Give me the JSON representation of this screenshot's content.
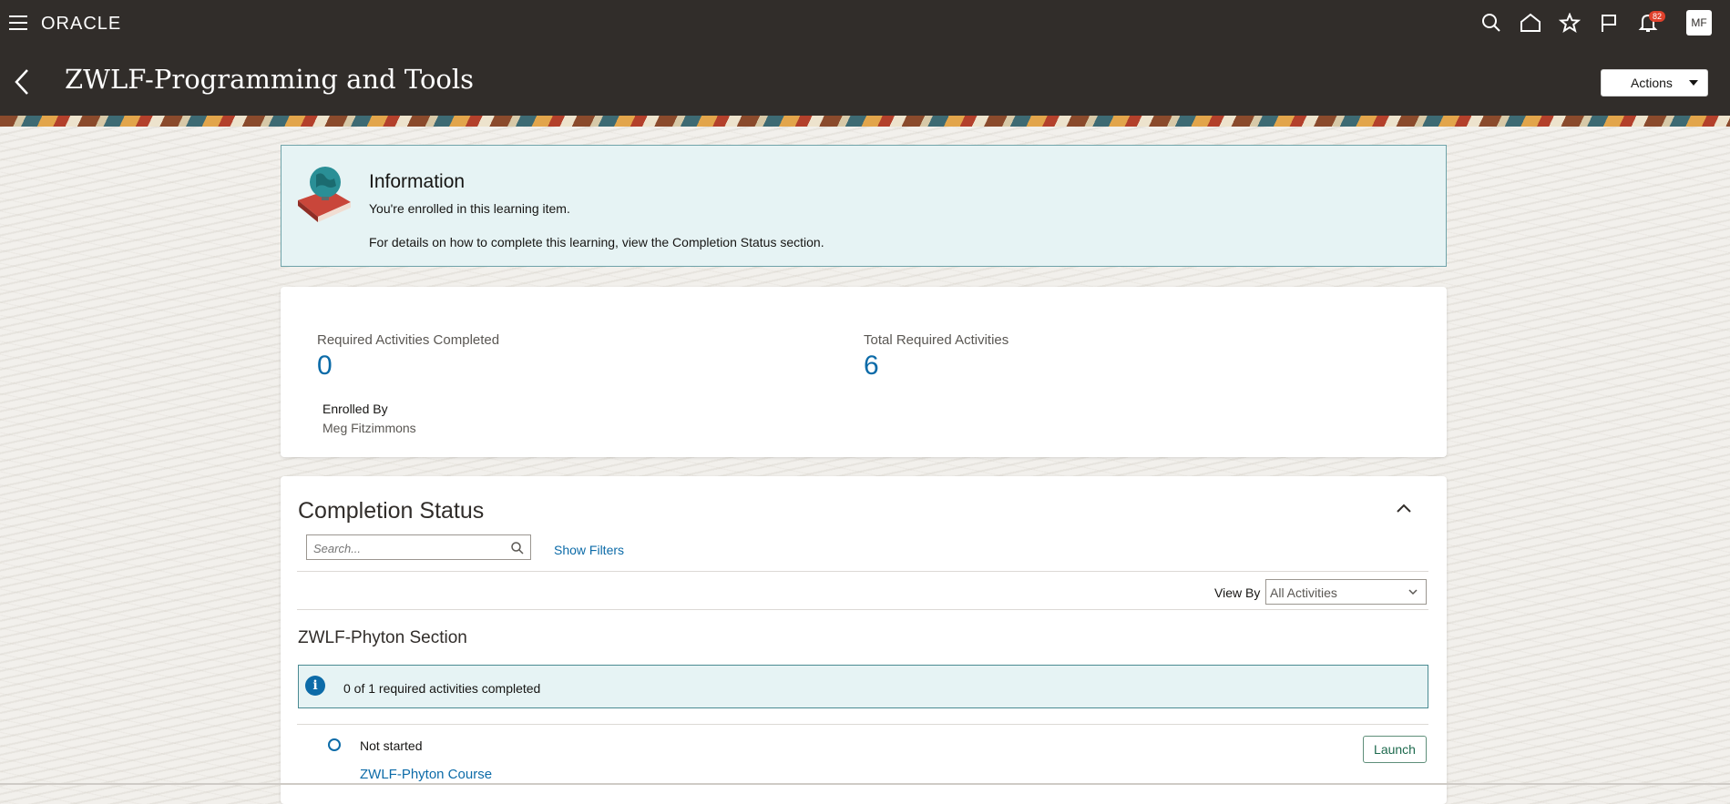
{
  "app": {
    "logo": "ORACLE"
  },
  "header": {
    "title": "ZWLF-Programming and Tools",
    "notifications_count": "82",
    "user_initials": "MF",
    "actions_label": "Actions"
  },
  "info": {
    "title": "Information",
    "line1": "You're enrolled in this learning item.",
    "line2": "For details on how to complete this learning, view the Completion Status section."
  },
  "stats": {
    "required_completed_label": "Required Activities Completed",
    "required_completed_value": "0",
    "total_required_label": "Total Required Activities",
    "total_required_value": "6",
    "enrolled_by_label": "Enrolled By",
    "enrolled_by_value": "Meg Fitzimmons"
  },
  "completion_status": {
    "title": "Completion Status",
    "search_placeholder": "Search...",
    "show_filters": "Show Filters",
    "view_by_label": "View By",
    "view_by_value": "All Activities",
    "section": {
      "title": "ZWLF-Phyton Section",
      "requirement_text": "0 of 1 required activities completed",
      "activity": {
        "status": "Not started",
        "name": "ZWLF-Phyton Course",
        "launch_label": "Launch"
      }
    }
  },
  "colors": {
    "header_bg": "#312d2a",
    "link": "#0c6ba8",
    "info_bg": "#e6f3f4"
  }
}
